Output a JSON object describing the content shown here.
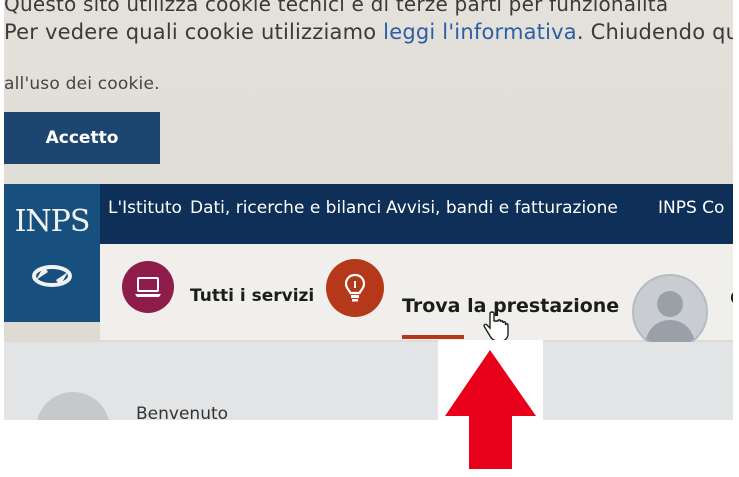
{
  "cookie_banner": {
    "line1": "Questo sito utilizza cookie tecnici e di terze parti per funzionalità",
    "line2_prefix": "Per vedere quali cookie utilizziamo ",
    "line2_link": "leggi l'informativa",
    "line2_suffix": ". Chiudendo questo",
    "line3": "all'uso dei cookie.",
    "accept_label": "Accetto"
  },
  "logo": {
    "text": "INPS"
  },
  "topnav": {
    "items": [
      "L'Istituto",
      "Dati, ricerche e bilanci",
      "Avvisi, bandi e fatturazione",
      "INPS Co"
    ]
  },
  "service_bar": {
    "tutti_servizi": "Tutti i servizi",
    "trova_prestazione": "Trova la prestazione",
    "truncated_label": "G"
  },
  "welcome": {
    "text": "Benvenuto"
  },
  "colors": {
    "accent_blue": "#1c4670",
    "nav_bg": "#0e2f58",
    "servizi_circle": "#8e1d4b",
    "trova_circle": "#b6381b",
    "arrow": "#e8001a"
  },
  "icons": [
    "laptop-icon",
    "lightbulb-icon",
    "user-avatar-icon",
    "hand-cursor-icon",
    "arrow-up-icon"
  ]
}
